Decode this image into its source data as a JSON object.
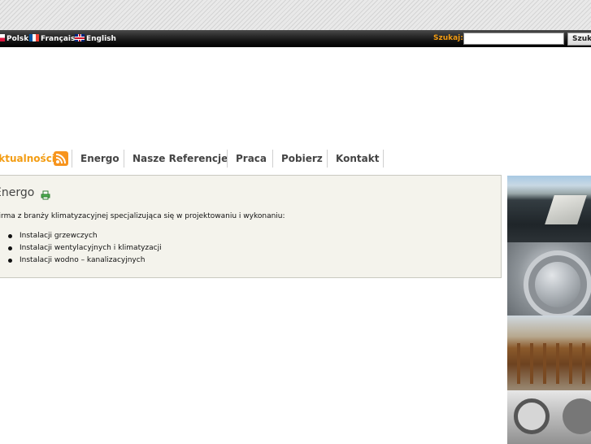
{
  "languages": [
    {
      "label": "Polski",
      "flag": "poland-flag-icon"
    },
    {
      "label": "Français",
      "flag": "france-flag-icon"
    },
    {
      "label": "English",
      "flag": "uk-flag-icon"
    }
  ],
  "search": {
    "label": "Szukaj:",
    "placeholder": "",
    "button_label": "Szukaj"
  },
  "nav": {
    "items": [
      {
        "label": "Aktualności",
        "active": true
      },
      {
        "label": "Energo"
      },
      {
        "label": "Nasze Referencje"
      },
      {
        "label": "Praca"
      },
      {
        "label": "Pobierz"
      },
      {
        "label": "Kontakt"
      }
    ]
  },
  "content": {
    "title": "Energo",
    "intro": "Firma z branży klimatyzacyjnej specjalizująca się w projektowaniu i wykonaniu:",
    "list": [
      "Instalacji grzewczych",
      "Instalacji wentylacyjnych i klimatyzacji",
      "Instalacji wodno – kanalizacyjnych"
    ]
  },
  "colors": {
    "accent": "#f39c12",
    "box_bg": "#f4f3ec"
  }
}
